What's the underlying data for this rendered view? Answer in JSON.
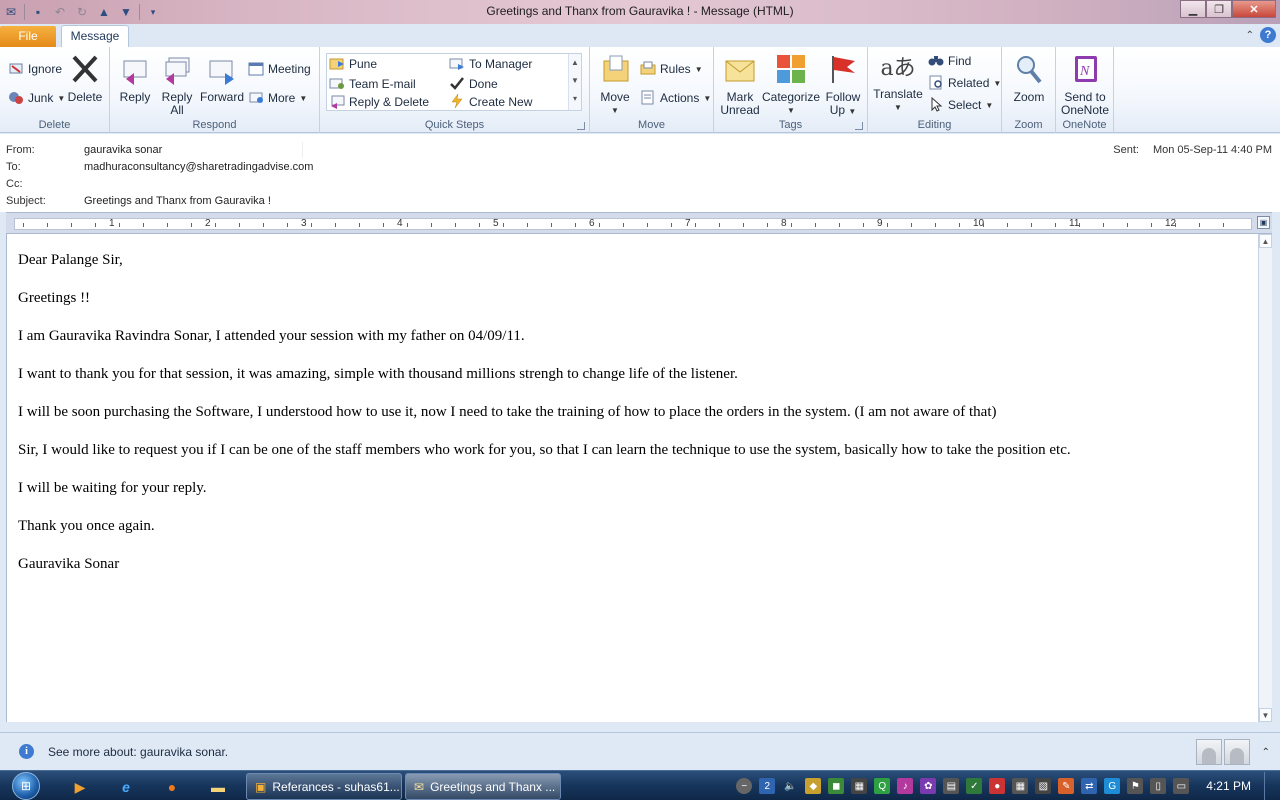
{
  "window": {
    "title": "Greetings and Thanx from Gauravika !  -  Message (HTML)"
  },
  "tabs": {
    "file": "File",
    "message": "Message"
  },
  "ribbon": {
    "delete_group": {
      "label": "Delete",
      "ignore": "Ignore",
      "junk": "Junk",
      "delete": "Delete"
    },
    "respond_group": {
      "label": "Respond",
      "reply": "Reply",
      "reply_all_1": "Reply",
      "reply_all_2": "All",
      "forward": "Forward",
      "meeting": "Meeting",
      "more": "More"
    },
    "quick_steps_group": {
      "label": "Quick Steps",
      "items": [
        "Pune",
        "To Manager",
        "Team E-mail",
        "Done",
        "Reply & Delete",
        "Create New"
      ]
    },
    "move_group": {
      "label": "Move",
      "move": "Move",
      "rules": "Rules",
      "actions": "Actions"
    },
    "tags_group": {
      "label": "Tags",
      "mark_unread_1": "Mark",
      "mark_unread_2": "Unread",
      "categorize": "Categorize",
      "follow_up_1": "Follow",
      "follow_up_2": "Up"
    },
    "editing_group": {
      "label": "Editing",
      "translate": "Translate",
      "find": "Find",
      "related": "Related",
      "select": "Select"
    },
    "zoom_group": {
      "label": "Zoom",
      "zoom": "Zoom"
    },
    "onenote_group": {
      "label": "OneNote",
      "send_1": "Send to",
      "send_2": "OneNote"
    }
  },
  "header": {
    "from_label": "From:",
    "from_value": "gauravika sonar",
    "to_label": "To:",
    "to_value": "madhuraconsultancy@sharetradingadvise.com",
    "cc_label": "Cc:",
    "cc_value": "",
    "subject_label": "Subject:",
    "subject_value": "Greetings and Thanx from Gauravika !",
    "sent_label": "Sent:",
    "sent_value": "Mon 05-Sep-11 4:40 PM"
  },
  "ruler": {
    "numbers": [
      "1",
      "2",
      "3",
      "4",
      "5",
      "6",
      "7",
      "8",
      "9",
      "10",
      "11",
      "12"
    ]
  },
  "body": {
    "paragraphs": [
      "Dear Palange Sir,",
      "Greetings !!",
      "I am Gauravika Ravindra Sonar, I attended your session with my father on 04/09/11.",
      "I want to thank you for that session, it was amazing, simple with thousand millions strengh to change life of the listener.",
      "I will be soon purchasing the Software, I understood how to use it, now I need to take the training of how to place the orders in the system. (I am not aware of that)",
      "Sir, I would like to request you if I can be one of the staff members who work for you, so that I can learn the technique to use the system, basically how to take the position etc.",
      "I will be waiting for your reply.",
      "Thank you once again.",
      "Gauravika Sonar"
    ]
  },
  "people_pane": {
    "text": "See more about: gauravika sonar."
  },
  "taskbar": {
    "tasks": [
      "Referances - suhas61...",
      "Greetings and Thanx ..."
    ],
    "clock": "4:21 PM"
  },
  "colors": {
    "file_tab": "#e48a1a",
    "taskbar": "#17355c",
    "ribbon_bg": "#f4f8fd"
  }
}
